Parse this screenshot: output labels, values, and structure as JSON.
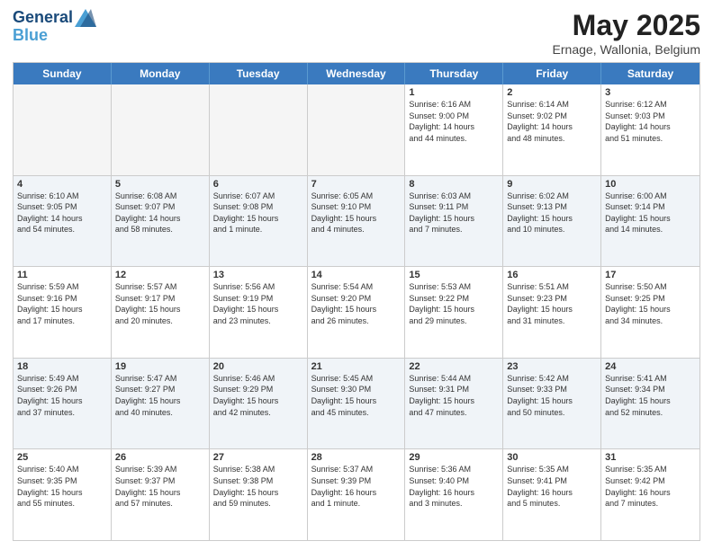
{
  "logo": {
    "line1": "General",
    "line2": "Blue"
  },
  "title": "May 2025",
  "location": "Ernage, Wallonia, Belgium",
  "dayNames": [
    "Sunday",
    "Monday",
    "Tuesday",
    "Wednesday",
    "Thursday",
    "Friday",
    "Saturday"
  ],
  "rows": [
    [
      {
        "date": "",
        "info": ""
      },
      {
        "date": "",
        "info": ""
      },
      {
        "date": "",
        "info": ""
      },
      {
        "date": "",
        "info": ""
      },
      {
        "date": "1",
        "info": "Sunrise: 6:16 AM\nSunset: 9:00 PM\nDaylight: 14 hours\nand 44 minutes."
      },
      {
        "date": "2",
        "info": "Sunrise: 6:14 AM\nSunset: 9:02 PM\nDaylight: 14 hours\nand 48 minutes."
      },
      {
        "date": "3",
        "info": "Sunrise: 6:12 AM\nSunset: 9:03 PM\nDaylight: 14 hours\nand 51 minutes."
      }
    ],
    [
      {
        "date": "4",
        "info": "Sunrise: 6:10 AM\nSunset: 9:05 PM\nDaylight: 14 hours\nand 54 minutes."
      },
      {
        "date": "5",
        "info": "Sunrise: 6:08 AM\nSunset: 9:07 PM\nDaylight: 14 hours\nand 58 minutes."
      },
      {
        "date": "6",
        "info": "Sunrise: 6:07 AM\nSunset: 9:08 PM\nDaylight: 15 hours\nand 1 minute."
      },
      {
        "date": "7",
        "info": "Sunrise: 6:05 AM\nSunset: 9:10 PM\nDaylight: 15 hours\nand 4 minutes."
      },
      {
        "date": "8",
        "info": "Sunrise: 6:03 AM\nSunset: 9:11 PM\nDaylight: 15 hours\nand 7 minutes."
      },
      {
        "date": "9",
        "info": "Sunrise: 6:02 AM\nSunset: 9:13 PM\nDaylight: 15 hours\nand 10 minutes."
      },
      {
        "date": "10",
        "info": "Sunrise: 6:00 AM\nSunset: 9:14 PM\nDaylight: 15 hours\nand 14 minutes."
      }
    ],
    [
      {
        "date": "11",
        "info": "Sunrise: 5:59 AM\nSunset: 9:16 PM\nDaylight: 15 hours\nand 17 minutes."
      },
      {
        "date": "12",
        "info": "Sunrise: 5:57 AM\nSunset: 9:17 PM\nDaylight: 15 hours\nand 20 minutes."
      },
      {
        "date": "13",
        "info": "Sunrise: 5:56 AM\nSunset: 9:19 PM\nDaylight: 15 hours\nand 23 minutes."
      },
      {
        "date": "14",
        "info": "Sunrise: 5:54 AM\nSunset: 9:20 PM\nDaylight: 15 hours\nand 26 minutes."
      },
      {
        "date": "15",
        "info": "Sunrise: 5:53 AM\nSunset: 9:22 PM\nDaylight: 15 hours\nand 29 minutes."
      },
      {
        "date": "16",
        "info": "Sunrise: 5:51 AM\nSunset: 9:23 PM\nDaylight: 15 hours\nand 31 minutes."
      },
      {
        "date": "17",
        "info": "Sunrise: 5:50 AM\nSunset: 9:25 PM\nDaylight: 15 hours\nand 34 minutes."
      }
    ],
    [
      {
        "date": "18",
        "info": "Sunrise: 5:49 AM\nSunset: 9:26 PM\nDaylight: 15 hours\nand 37 minutes."
      },
      {
        "date": "19",
        "info": "Sunrise: 5:47 AM\nSunset: 9:27 PM\nDaylight: 15 hours\nand 40 minutes."
      },
      {
        "date": "20",
        "info": "Sunrise: 5:46 AM\nSunset: 9:29 PM\nDaylight: 15 hours\nand 42 minutes."
      },
      {
        "date": "21",
        "info": "Sunrise: 5:45 AM\nSunset: 9:30 PM\nDaylight: 15 hours\nand 45 minutes."
      },
      {
        "date": "22",
        "info": "Sunrise: 5:44 AM\nSunset: 9:31 PM\nDaylight: 15 hours\nand 47 minutes."
      },
      {
        "date": "23",
        "info": "Sunrise: 5:42 AM\nSunset: 9:33 PM\nDaylight: 15 hours\nand 50 minutes."
      },
      {
        "date": "24",
        "info": "Sunrise: 5:41 AM\nSunset: 9:34 PM\nDaylight: 15 hours\nand 52 minutes."
      }
    ],
    [
      {
        "date": "25",
        "info": "Sunrise: 5:40 AM\nSunset: 9:35 PM\nDaylight: 15 hours\nand 55 minutes."
      },
      {
        "date": "26",
        "info": "Sunrise: 5:39 AM\nSunset: 9:37 PM\nDaylight: 15 hours\nand 57 minutes."
      },
      {
        "date": "27",
        "info": "Sunrise: 5:38 AM\nSunset: 9:38 PM\nDaylight: 15 hours\nand 59 minutes."
      },
      {
        "date": "28",
        "info": "Sunrise: 5:37 AM\nSunset: 9:39 PM\nDaylight: 16 hours\nand 1 minute."
      },
      {
        "date": "29",
        "info": "Sunrise: 5:36 AM\nSunset: 9:40 PM\nDaylight: 16 hours\nand 3 minutes."
      },
      {
        "date": "30",
        "info": "Sunrise: 5:35 AM\nSunset: 9:41 PM\nDaylight: 16 hours\nand 5 minutes."
      },
      {
        "date": "31",
        "info": "Sunrise: 5:35 AM\nSunset: 9:42 PM\nDaylight: 16 hours\nand 7 minutes."
      }
    ]
  ]
}
